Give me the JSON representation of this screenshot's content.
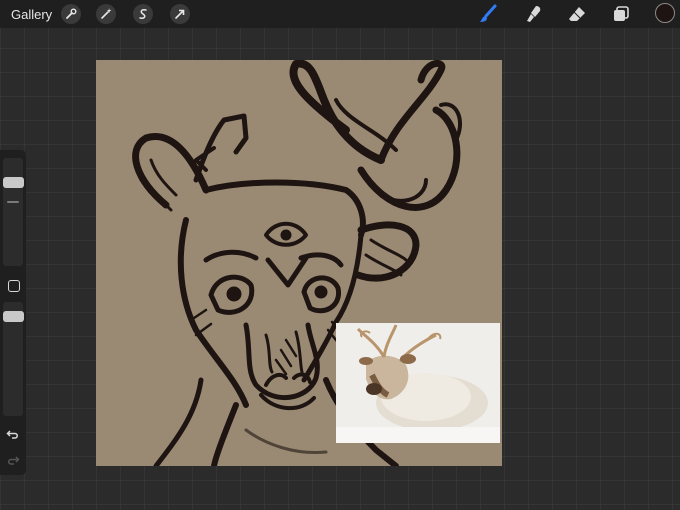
{
  "topbar": {
    "gallery_label": "Gallery",
    "action_icons": [
      "wrench-icon",
      "magic-wand-icon",
      "selection-icon",
      "transform-arrow-icon"
    ],
    "tool_icons": [
      "brush-icon",
      "smudge-icon",
      "eraser-icon",
      "layers-icon"
    ],
    "active_tool": "brush",
    "active_color": "#1e1512"
  },
  "sidebar": {
    "brush_size": 0.22,
    "brush_opacity": 0.2,
    "icons": [
      "modify-button-icon",
      "undo-icon",
      "redo-icon"
    ]
  },
  "canvas": {
    "background_color": "#9b8a73",
    "ink_color": "#1e1512"
  },
  "reference": {
    "subject": "reindeer-photo"
  }
}
